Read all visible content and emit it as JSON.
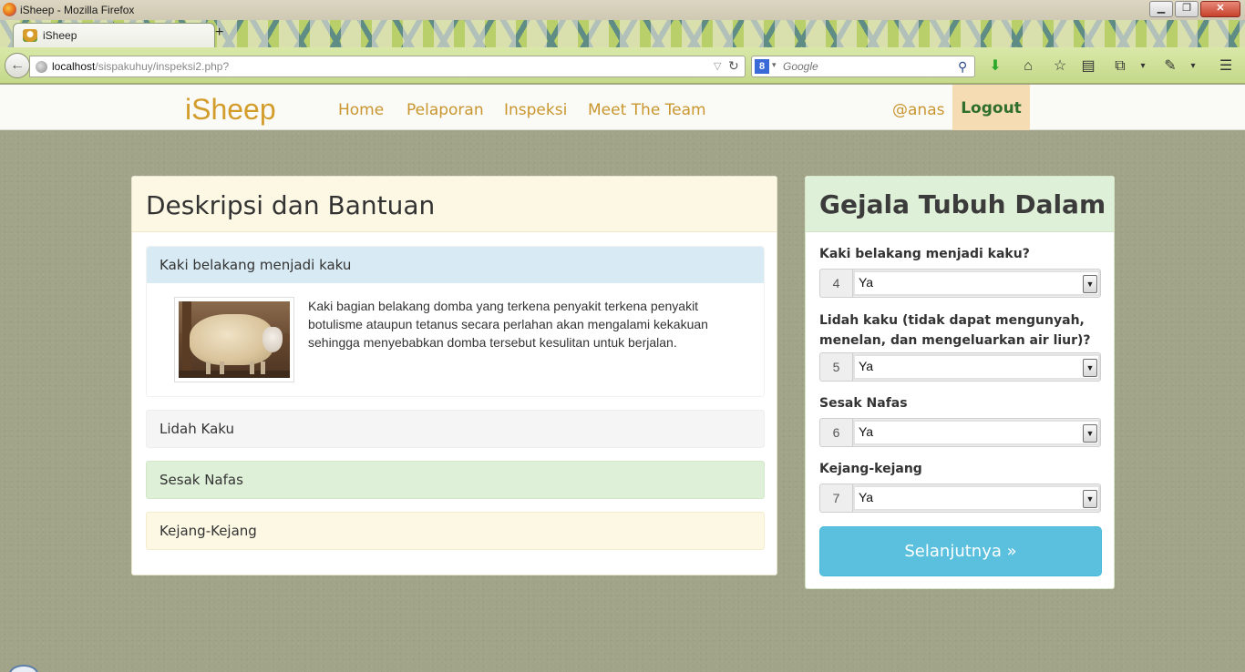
{
  "window": {
    "title": "iSheep - Mozilla Firefox",
    "min_label": "▁",
    "max_label": "❐",
    "close_label": "✕"
  },
  "browser": {
    "tab_title": "iSheep",
    "new_tab": "+",
    "url_host": "localhost",
    "url_path": "/sispakuhuy/inspeksi2.php?",
    "search_engine_letter": "8",
    "search_placeholder": "Google",
    "icons": [
      "download-icon",
      "home-icon",
      "bookmark-star-icon",
      "reader-icon",
      "screenshot-icon",
      "eyedropper-icon",
      "menu-icon"
    ]
  },
  "site": {
    "brand": "iSheep",
    "nav": {
      "home": "Home",
      "pelaporan": "Pelaporan",
      "inspeksi": "Inspeksi",
      "team": "Meet The Team",
      "user": "@anas",
      "logout": "Logout"
    },
    "colors": {
      "brand": "#d39d2c",
      "logout_bg": "#f6dcb2",
      "logout_text": "#2f6e2d",
      "next_button": "#5bc0de"
    }
  },
  "help_panel": {
    "title": "Deskripsi dan Bantuan",
    "items": [
      {
        "label": "Kaki belakang menjadi kaku",
        "body": "Kaki bagian belakang domba yang terkena penyakit terkena penyakit botulisme ataupun tetanus secara perlahan akan mengalami kekakuan sehingga menyebabkan domba tersebut kesulitan untuk berjalan."
      },
      {
        "label": "Lidah Kaku"
      },
      {
        "label": "Sesak Nafas"
      },
      {
        "label": "Kejang-Kejang"
      }
    ]
  },
  "form_panel": {
    "title": "Gejala Tubuh Dalam",
    "questions": [
      {
        "label": "Kaki belakang menjadi kaku?",
        "number": "4",
        "value": "Ya"
      },
      {
        "label": "Lidah kaku (tidak dapat mengunyah, menelan, dan mengeluarkan air liur)?",
        "number": "5",
        "value": "Ya"
      },
      {
        "label": "Sesak Nafas",
        "number": "6",
        "value": "Ya"
      },
      {
        "label": "Kejang-kejang",
        "number": "7",
        "value": "Ya"
      }
    ],
    "submit": "Selanjutnya »"
  }
}
